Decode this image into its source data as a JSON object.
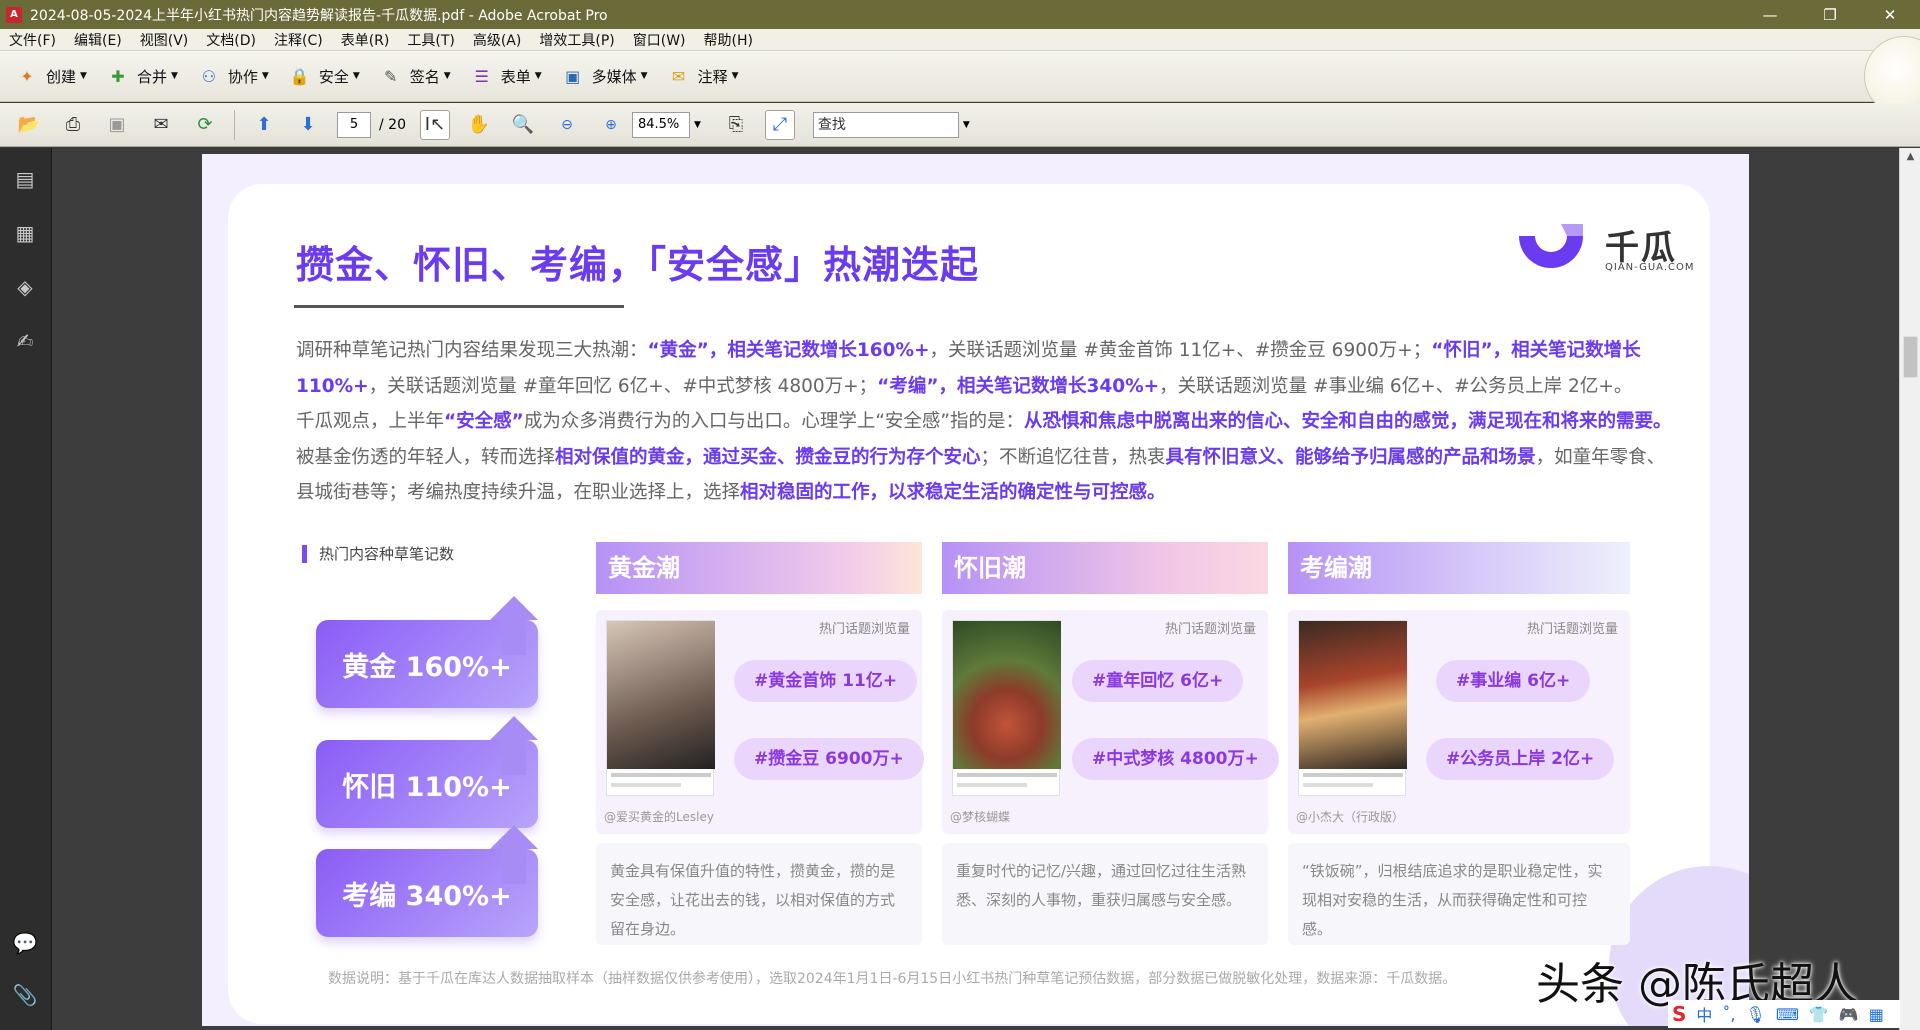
{
  "window": {
    "title": "2024-08-05-2024上半年小红书热门内容趋势解读报告-千瓜数据.pdf - Adobe Acrobat Pro",
    "app_icon_label": "A",
    "controls": {
      "minimize": "—",
      "restore": "❐",
      "close": "✕"
    }
  },
  "menu": [
    "文件(F)",
    "编辑(E)",
    "视图(V)",
    "文档(D)",
    "注释(C)",
    "表单(R)",
    "工具(T)",
    "高级(A)",
    "增效工具(P)",
    "窗口(W)",
    "帮助(H)"
  ],
  "toolbar1": [
    {
      "label": "创建",
      "icon": "create-icon",
      "glyph": "✦",
      "color": "#e07a1f"
    },
    {
      "label": "合并",
      "icon": "merge-icon",
      "glyph": "✚",
      "color": "#3a9a3a"
    },
    {
      "label": "协作",
      "icon": "collaborate-icon",
      "glyph": "⚇",
      "color": "#3b6fc4"
    },
    {
      "label": "安全",
      "icon": "lock-icon",
      "glyph": "🔒",
      "color": "#c08a1a"
    },
    {
      "label": "签名",
      "icon": "pen-icon",
      "glyph": "✎",
      "color": "#555555"
    },
    {
      "label": "表单",
      "icon": "form-icon",
      "glyph": "☰",
      "color": "#7a3aa8"
    },
    {
      "label": "多媒体",
      "icon": "multimedia-icon",
      "glyph": "▣",
      "color": "#2b6ab0"
    },
    {
      "label": "注释",
      "icon": "comment-icon",
      "glyph": "✉",
      "color": "#d8a21a"
    }
  ],
  "toolbar2": {
    "page_current": "5",
    "page_total": "/ 20",
    "zoom": "84.5%",
    "search_placeholder": "查找"
  },
  "page": {
    "heading": "攒金、怀旧、考编，「安全感」热潮迭起",
    "logo_cn": "千瓜",
    "logo_en": "QIAN-GUA.COM",
    "para": [
      {
        "t": "调研种草笔记热门内容结果发现三大热潮：",
        "b": false
      },
      {
        "t": "“黄金”，相关笔记数增长160%+",
        "b": true
      },
      {
        "t": "，关联话题浏览量 #黄金首饰 11亿+、#攒金豆 6900万+；",
        "b": false
      },
      {
        "t": "“怀旧”，相关笔记数增长110%+",
        "b": true
      },
      {
        "t": "，关联话题浏览量 #童年回忆 6亿+、#中式梦核 4800万+；",
        "b": false
      },
      {
        "t": "“考编”，相关笔记数增长340%+",
        "b": true
      },
      {
        "t": "，关联话题浏览量 #事业编 6亿+、#公务员上岸 2亿+。",
        "b": false
      },
      {
        "t": "千瓜观点，上半年",
        "b": false,
        "br": true
      },
      {
        "t": "“安全感”",
        "b": true
      },
      {
        "t": "成为众多消费行为的入口与出口。心理学上“安全感”指的是：",
        "b": false
      },
      {
        "t": "从恐惧和焦虑中脱离出来的信心、安全和自由的感觉，满足现在和将来的需要。",
        "b": true
      },
      {
        "t": "被基金伤透的年轻人，转而选择",
        "b": false
      },
      {
        "t": "相对保值的黄金，通过买金、攒金豆的行为存个安心",
        "b": true
      },
      {
        "t": "；不断追忆往昔，热衷",
        "b": false
      },
      {
        "t": "具有怀旧意义、能够给予归属感的产品和场景",
        "b": true
      },
      {
        "t": "，如童年零食、县城街巷等；考编热度持续升温，在职业选择上，选择",
        "b": false
      },
      {
        "t": "相对稳固的工作，以求稳定生活的确定性与可控感。",
        "b": true
      }
    ],
    "section_label": "热门内容种草笔记数",
    "stats": [
      "黄金 160%+",
      "怀旧 110%+",
      "考编 340%+"
    ],
    "columns": [
      {
        "title": "黄金潮",
        "card_label": "热门话题浏览量",
        "author": "@爱买黄金的Lesley",
        "pills": [
          "#黄金首饰 11亿+",
          "#攒金豆 6900万+"
        ],
        "desc": "黄金具有保值升值的特性，攒黄金，攒的是安全感，让花出去的钱，以相对保值的方式留在身边。"
      },
      {
        "title": "怀旧潮",
        "card_label": "热门话题浏览量",
        "author": "@梦核蝴蝶",
        "pills": [
          "#童年回忆 6亿+",
          "#中式梦核 4800万+"
        ],
        "desc": "重复时代的记忆/兴趣，通过回忆过往生活熟悉、深刻的人事物，重获归属感与安全感。"
      },
      {
        "title": "考编潮",
        "card_label": "热门话题浏览量",
        "author": "@小杰大（行政版）",
        "pills": [
          "#事业编 6亿+",
          "#公务员上岸 2亿+"
        ],
        "desc": "“铁饭碗”，归根结底追求的是职业稳定性，实现相对安稳的生活，从而获得确定性和可控感。"
      }
    ],
    "footnote": "数据说明：基于千瓜在库达人数据抽取样本（抽样数据仅供参考使用），选取2024年1月1日-6月15日小红书热门种草笔记预估数据，部分数据已做脱敏化处理，数据来源：千瓜数据。",
    "watermark": "头条 @陈氏超人"
  },
  "ime": {
    "logo": "S",
    "lang": "中"
  }
}
